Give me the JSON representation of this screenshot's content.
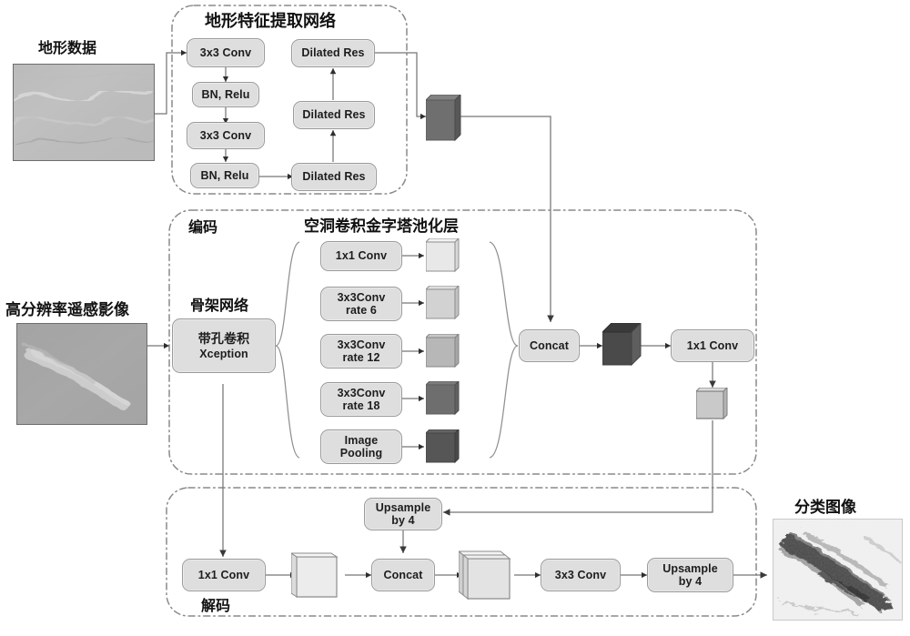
{
  "figure": {
    "type": "neural-network-architecture-diagram",
    "title_visible": false
  },
  "inputs": [
    {
      "id": "terrain",
      "caption": "地形数据",
      "image": "grayscale-terrain-dem"
    },
    {
      "id": "rsimage",
      "caption": "高分辨率遥感影像",
      "image": "grayscale-remote-sensing-image"
    }
  ],
  "output": {
    "id": "classified",
    "caption": "分类图像",
    "image": "grayscale-classification-map"
  },
  "groups": [
    {
      "id": "terrain_net",
      "label": "地形特征提取网络"
    },
    {
      "id": "encoder",
      "label": "编码"
    },
    {
      "id": "decoder",
      "label": "解码"
    }
  ],
  "section_labels": {
    "aspp": "空洞卷积金字塔池化层",
    "backbone": "骨架网络"
  },
  "terrain_net": {
    "left_column": [
      {
        "label": "3x3 Conv"
      },
      {
        "label": "BN, Relu"
      },
      {
        "label": "3x3 Conv"
      },
      {
        "label": "BN, Relu"
      }
    ],
    "right_column": [
      {
        "label": "Dilated Res"
      },
      {
        "label": "Dilated Res"
      },
      {
        "label": "Dilated Res"
      }
    ],
    "output_feature": {
      "name": "terrain-feature-cube",
      "color": "#6f6f6f"
    }
  },
  "encoder": {
    "backbone": {
      "line1": "带孔卷积",
      "line2": "Xception"
    },
    "aspp_branches": [
      {
        "label_1": "1x1 Conv",
        "label_2": "",
        "feature_color": "#e8e8e8"
      },
      {
        "label_1": "3x3Conv",
        "label_2": "rate 6",
        "feature_color": "#d2d2d2"
      },
      {
        "label_1": "3x3Conv",
        "label_2": "rate 12",
        "feature_color": "#b7b7b7"
      },
      {
        "label_1": "3x3Conv",
        "label_2": "rate 18",
        "feature_color": "#6e6e6e"
      },
      {
        "label_1": "Image",
        "label_2": "Pooling",
        "feature_color": "#565656"
      }
    ],
    "concat": {
      "label": "Concat"
    },
    "concat_feature": {
      "name": "encoder-concat-cube",
      "color": "#4a4a4a"
    },
    "conv1x1": {
      "label": "1x1 Conv"
    },
    "conv1x1_feature": {
      "name": "encoder-output-feature",
      "color": "#c9c9c9"
    }
  },
  "decoder": {
    "conv1x1": {
      "label": "1x1 Conv"
    },
    "low_level_feature": {
      "name": "decoder-low-level-feature",
      "color": "#ececec"
    },
    "upsample_top": {
      "label_1": "Upsample",
      "label_2": "by 4"
    },
    "concat": {
      "label": "Concat"
    },
    "concat_feature": {
      "name": "decoder-concat-feature",
      "color": "#e3e3e3"
    },
    "conv3x3": {
      "label": "3x3 Conv"
    },
    "upsample_out": {
      "label_1": "Upsample",
      "label_2": "by 4"
    }
  },
  "colors": {
    "node_fill": "#dededf",
    "node_stroke": "#9a9a9a",
    "wire": "#767676",
    "group_border": "#8a8a8a",
    "text": "#1a1a1a"
  }
}
